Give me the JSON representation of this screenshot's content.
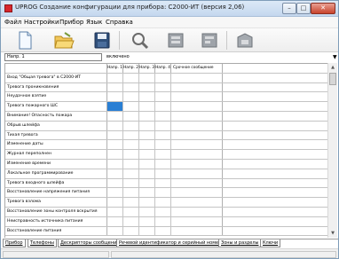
{
  "window": {
    "title": "UPROG Создание конфигурации для прибора: С2000-ИТ (версия 2,06)"
  },
  "menu": [
    "Файл",
    "Настройки",
    "Прибор",
    "Язык",
    "Справка"
  ],
  "toolbar": {
    "buttons": [
      "new-document-icon",
      "open-folder-icon",
      "save-floppy-icon",
      "search-icon",
      "read-from-device-icon",
      "write-to-device-icon",
      "device-icon"
    ]
  },
  "direction": {
    "selected": "Напр. 1",
    "state": "включено"
  },
  "grid": {
    "columns": [
      "Напр. 1",
      "Напр. 2",
      "Напр. 3",
      "Напр. 4",
      "Срочное сообщение"
    ],
    "rows": [
      "Вход \"Общая тревога\" в С2000-ИТ",
      "Тревога проникновения",
      "Неудачное взятие",
      "Тревога пожарного ШС",
      "Внимание! Опасность пожара",
      "Обрыв шлейфа",
      "Тихая тревога",
      "Изменение даты",
      "Журнал переполнен",
      "Изменение времени",
      "Локальное программирование",
      "Тревога входного шлейфа",
      "Восстановление напряжения питания",
      "Тревога взлома",
      "Восстановление зоны контроля вскрытия",
      "Неисправность источника питания",
      "Восстановление питания"
    ],
    "selected_row": 3,
    "selected_col": 0
  },
  "tabs": [
    "Прибор",
    "Телефоны",
    "Дескрипторы сообщений",
    "Речевой идентификатор и серийный номер",
    "Зоны и разделы",
    "Ключи"
  ],
  "colors": {
    "selection": "#2a7fd4",
    "close_button": "#c8432c"
  }
}
